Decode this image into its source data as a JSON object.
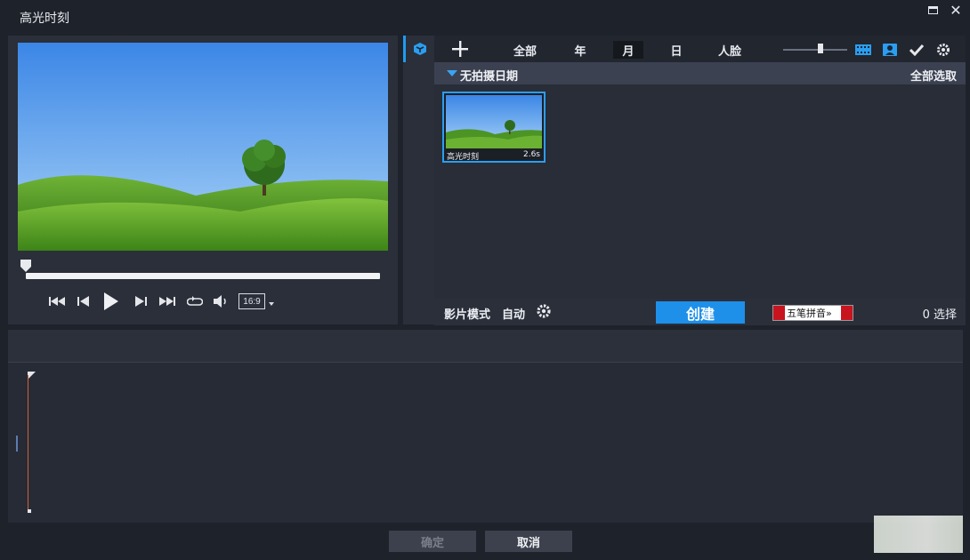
{
  "window": {
    "title": "高光时刻"
  },
  "player": {
    "aspect_ratio": "16:9",
    "progress": 0
  },
  "library": {
    "tabs": [
      {
        "label": "全部",
        "active": false
      },
      {
        "label": "年",
        "active": false
      },
      {
        "label": "月",
        "active": true
      },
      {
        "label": "日",
        "active": false
      },
      {
        "label": "人脸",
        "active": false
      }
    ],
    "group": {
      "title": "无拍摄日期",
      "select_all": "全部选取"
    },
    "items": [
      {
        "name": "高光时刻",
        "duration": "2.6s",
        "selected": true
      }
    ],
    "movie_mode_label": "影片模式",
    "movie_mode_value": "自动",
    "create_label": "创建",
    "ime_text": "五笔拼音»",
    "selection_count": "0 选择"
  },
  "footer": {
    "ok_label": "确定",
    "cancel_label": "取消"
  },
  "colors": {
    "accent": "#1e90ea",
    "panel": "#2a2f3a",
    "background": "#1e222a",
    "cursor": "#d2623a"
  }
}
